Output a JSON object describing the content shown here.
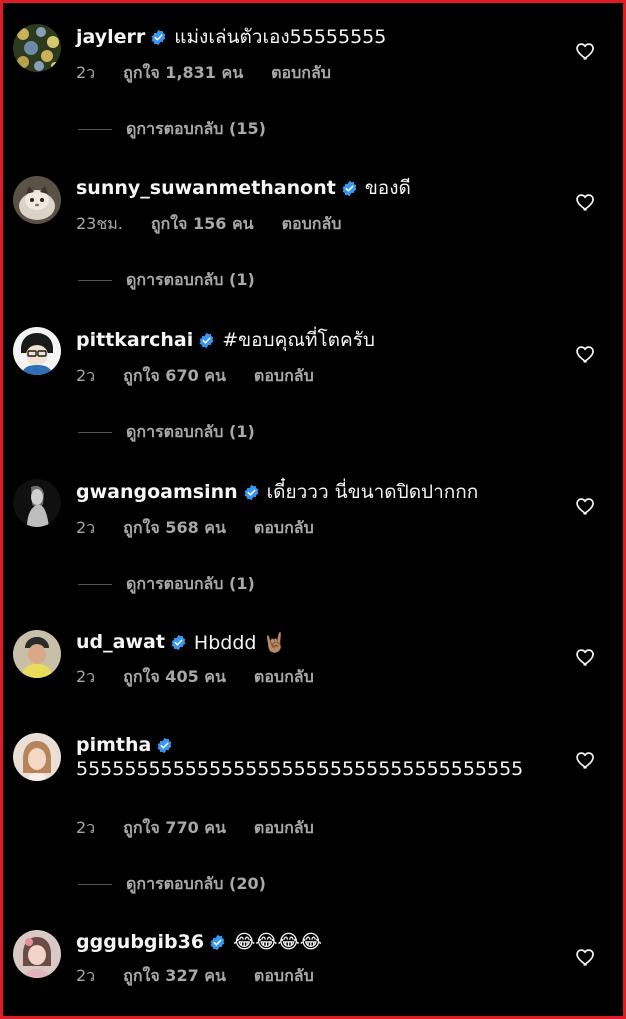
{
  "comments": [
    {
      "username": "jaylerr",
      "text": "แม่งเล่นตัวเอง55555555",
      "time": "2ว",
      "likes": "ถูกใจ 1,831 คน",
      "reply_label": "ตอบกลับ",
      "view_replies": "ดูการตอบกลับ (15)",
      "avatar": "avatar-floral-pattern"
    },
    {
      "username": "sunny_suwanmethanont",
      "text": "ของดี",
      "time": "23ชม.",
      "likes": "ถูกใจ 156 คน",
      "reply_label": "ตอบกลับ",
      "view_replies": "ดูการตอบกลับ (1)",
      "avatar": "avatar-cat"
    },
    {
      "username": "pittkarchai",
      "text": "#ขอบคุณที่โตครับ",
      "time": "2ว",
      "likes": "ถูกใจ 670 คน",
      "reply_label": "ตอบกลับ",
      "view_replies": "ดูการตอบกลับ (1)",
      "avatar": "avatar-cartoon"
    },
    {
      "username": "gwangoamsinn",
      "text": "เดี๋ยววว นี่ขนาดปิดปากกก",
      "time": "2ว",
      "likes": "ถูกใจ 568 คน",
      "reply_label": "ตอบกลับ",
      "view_replies": "ดูการตอบกลับ (1)",
      "avatar": "avatar-bw-portrait"
    },
    {
      "username": "ud_awat",
      "text": "Hbddd 🤘🏽",
      "time": "2ว",
      "likes": "ถูกใจ 405 คน",
      "reply_label": "ตอบกลับ",
      "avatar": "avatar-man-cap"
    },
    {
      "username": "pimtha",
      "text": "5555555555555555555555555555555555555",
      "time": "2ว",
      "likes": "ถูกใจ 770 คน",
      "reply_label": "ตอบกลับ",
      "view_replies": "ดูการตอบกลับ (20)",
      "avatar": "avatar-woman-light"
    },
    {
      "username": "gggubgib36",
      "text": "😂😂😂😂",
      "time": "2ว",
      "likes": "ถูกใจ 327 คน",
      "reply_label": "ตอบกลับ",
      "avatar": "avatar-woman-pink"
    }
  ],
  "icons": {
    "verified": "verified-badge-icon",
    "like": "heart-outline-icon"
  },
  "colors": {
    "background": "#000000",
    "text_primary": "#f5f5f5",
    "text_secondary": "#a8a8a8",
    "verified_blue": "#3897f0",
    "frame_red": "#e11b22"
  }
}
